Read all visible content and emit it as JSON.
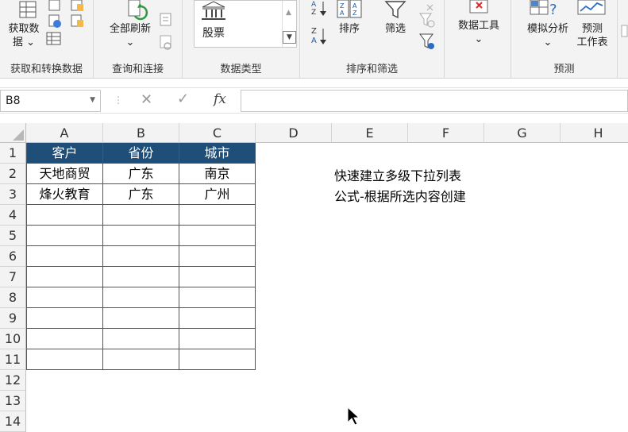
{
  "ribbon": {
    "groups": [
      {
        "label": "获取和转换数据"
      },
      {
        "label": "查询和连接"
      },
      {
        "label": "数据类型"
      },
      {
        "label": "排序和筛选"
      },
      {
        "label": "预测"
      }
    ],
    "buttons": {
      "get_data_1": "获取数",
      "get_data_2": "据 ⌄",
      "refresh_all": "全部刷新",
      "refresh_caret": "⌄",
      "stock": "股票",
      "sort": "排序",
      "filter": "筛选",
      "data_tools": "数据工具",
      "data_tools_caret": "⌄",
      "what_if": "模拟分析",
      "what_if_caret": "⌄",
      "forecast_sheet_1": "预测",
      "forecast_sheet_2": "工作表"
    }
  },
  "formula_bar": {
    "name_box": "B8",
    "formula": ""
  },
  "columns": [
    "A",
    "B",
    "C",
    "D",
    "E",
    "F",
    "G",
    "H"
  ],
  "rows": [
    "1",
    "2",
    "3",
    "4",
    "5",
    "6",
    "7",
    "8",
    "9",
    "10",
    "11",
    "12",
    "13",
    "14"
  ],
  "table": {
    "headers": [
      "客户",
      "省份",
      "城市"
    ],
    "rows": [
      [
        "天地商贸",
        "广东",
        "南京"
      ],
      [
        "烽火教育",
        "广东",
        "广州"
      ]
    ]
  },
  "notes": {
    "line1": "快速建立多级下拉列表",
    "line2": "公式-根据所选内容创建"
  },
  "colors": {
    "header_fill": "#1f4e79",
    "ribbon_bg": "#f3f3f3"
  }
}
